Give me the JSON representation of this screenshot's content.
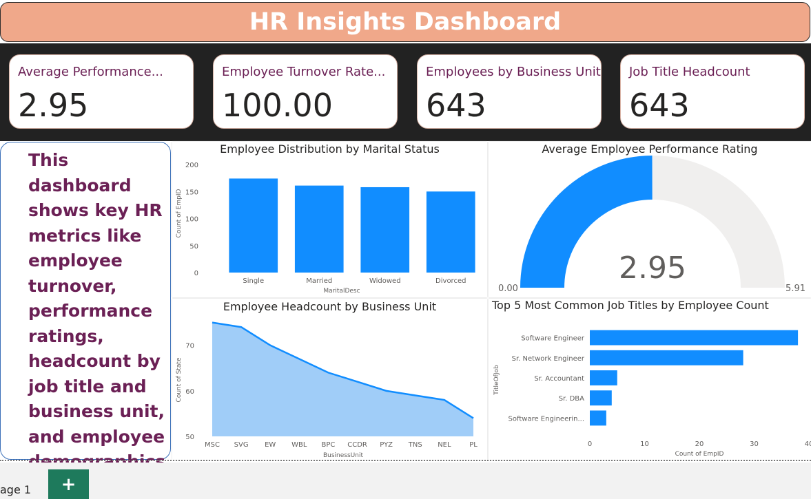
{
  "header": {
    "title": "HR Insights Dashboard"
  },
  "kpis": [
    {
      "label": "Average Performance...",
      "value": "2.95"
    },
    {
      "label": "Employee Turnover Rate...",
      "value": "100.00"
    },
    {
      "label": "Employees by Business Unit",
      "value": "643"
    },
    {
      "label": "Job Title Headcount",
      "value": "643"
    }
  ],
  "description": "This dashboard shows key HR metrics like employee turnover, performance ratings, headcount by job title and business unit, and  employee demographics.",
  "chart_data": [
    {
      "type": "bar",
      "title": "Employee Distribution by Marital Status",
      "xlabel": "MaritalDesc",
      "ylabel": "Count of EmpID",
      "categories": [
        "Single",
        "Married",
        "Widowed",
        "Divorced"
      ],
      "values": [
        174,
        161,
        158,
        150
      ],
      "ylim": [
        0,
        200
      ],
      "yticks": [
        "0",
        "50",
        "100",
        "150",
        "200"
      ],
      "color": "#118dff",
      "grid": false
    },
    {
      "type": "gauge",
      "title": "Average Employee Performance Rating",
      "value": 2.95,
      "value_label": "2.95",
      "min": 0,
      "max": 5.91,
      "min_label": "0.00",
      "max_label": "5.91",
      "fill_color": "#118dff",
      "track_color": "#f0efee"
    },
    {
      "type": "area",
      "title": "Employee Headcount by Business Unit",
      "xlabel": "BusinessUnit",
      "ylabel": "Count of State",
      "categories": [
        "MSC",
        "SVG",
        "EW",
        "WBL",
        "BPC",
        "CCDR",
        "PYZ",
        "TNS",
        "NEL",
        "PL"
      ],
      "values": [
        75,
        74,
        70,
        67,
        64,
        62,
        60,
        59,
        58,
        54
      ],
      "ylim": [
        50,
        76
      ],
      "yticks": [
        "50",
        "60",
        "70"
      ],
      "line_color": "#118dff",
      "fill_color": "#a0cdf8"
    },
    {
      "type": "bar",
      "orientation": "horizontal",
      "title": "Top 5 Most Common Job Titles by Employee Count",
      "xlabel": "Count of EmpID",
      "ylabel": "TitleOfJob",
      "categories": [
        "Software Engineer",
        "Sr. Network Engineer",
        "Sr. Accountant",
        "Sr. DBA",
        "Software Engineerin..."
      ],
      "values": [
        38,
        28,
        5,
        4,
        3
      ],
      "xlim": [
        0,
        40
      ],
      "xticks": [
        "0",
        "10",
        "20",
        "30",
        "40"
      ],
      "color": "#118dff"
    }
  ],
  "footer": {
    "page_tab": "age 1",
    "add_label": "+"
  }
}
